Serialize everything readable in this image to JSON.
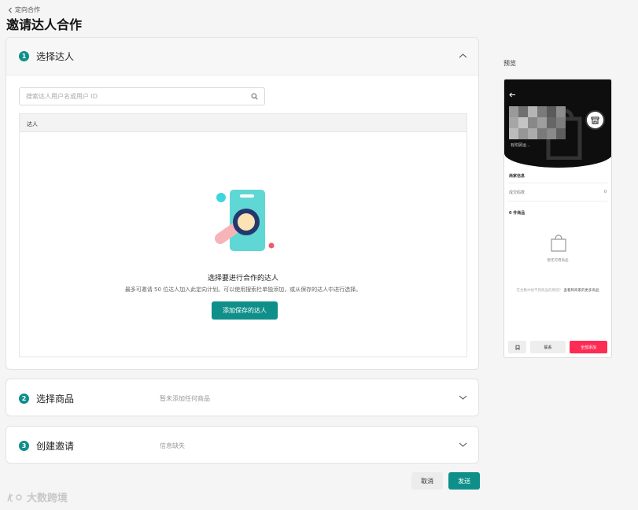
{
  "header": {
    "back_label": "定向合作",
    "title": "邀请达人合作"
  },
  "steps": [
    {
      "number": "1",
      "title": "选择达人",
      "subtitle": ""
    },
    {
      "number": "2",
      "title": "选择商品",
      "subtitle": "暂未添加任何商品"
    },
    {
      "number": "3",
      "title": "创建邀请",
      "subtitle": "信息缺失"
    }
  ],
  "search": {
    "placeholder": "搜索达人用户名或用户 ID"
  },
  "table": {
    "column_header": "达人"
  },
  "empty_state": {
    "title": "选择要进行合作的达人",
    "description": "最多可邀请 50 位达人加入此定向计划。可以使用搜索栏单独添加，或从保存的达人中进行选择。",
    "button_label": "添加保存的达人"
  },
  "actions": {
    "cancel": "取消",
    "send": "发送"
  },
  "preview": {
    "label": "预览",
    "shop_name": "有附顾运...",
    "merchant_label": "商家信息",
    "sales_label": "成交码数",
    "sales_value": "0",
    "products_label": "0 件商品",
    "empty_products": "暂无可用商品",
    "note_text": "在合集中找不到商品的原因？",
    "note_link": "查看和商家的更多商品",
    "btn_contact": "联系",
    "btn_add_all": "全部添加"
  },
  "watermark": "大数跨境",
  "colors": {
    "accent": "#0f8f8a",
    "pink": "#fe2c55"
  }
}
